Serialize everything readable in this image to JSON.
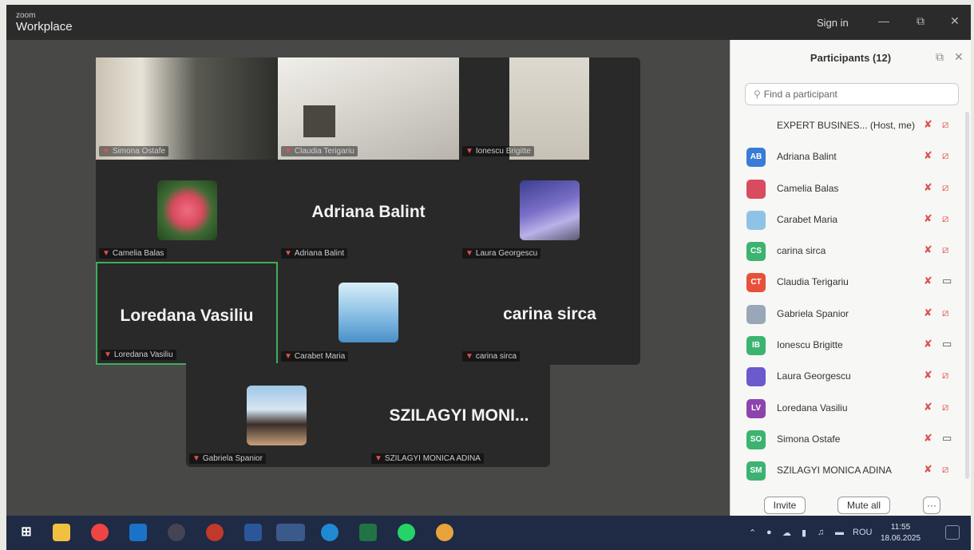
{
  "titlebar": {
    "brand_small": "zoom",
    "brand_name": "Workplace",
    "sign_in": "Sign in",
    "minimize": "—",
    "restore": "⧉",
    "close": "✕"
  },
  "gallery": {
    "tiles": [
      {
        "label": "Simona Ostafe",
        "center_name": ""
      },
      {
        "label": "Claudia Terigariu",
        "center_name": ""
      },
      {
        "label": "Ionescu Brigitte",
        "center_name": ""
      },
      {
        "label": "Camelia Balas",
        "center_name": ""
      },
      {
        "label": "Adriana Balint",
        "center_name": "Adriana Balint"
      },
      {
        "label": "Laura Georgescu",
        "center_name": ""
      },
      {
        "label": "Loredana Vasiliu",
        "center_name": "Loredana Vasiliu"
      },
      {
        "label": "Carabet Maria",
        "center_name": ""
      },
      {
        "label": "carina sirca",
        "center_name": "carina sirca"
      },
      {
        "label": "Gabriela Spanior",
        "center_name": ""
      },
      {
        "label": "SZILAGYI MONICA ADINA",
        "center_name": "SZILAGYI  MONI..."
      }
    ],
    "active_speaker_color": "#3fae5a"
  },
  "participants": {
    "title": "Participants (12)",
    "popout_icon": "⧉",
    "close_icon": "✕",
    "search_placeholder": "Find a participant",
    "list": [
      {
        "initials": "",
        "name": "EXPERT BUSINES... (Host, me)",
        "color": "#ffffff",
        "mic": "muted",
        "cam": "off"
      },
      {
        "initials": "AB",
        "name": "Adriana Balint",
        "color": "#3a7bd5",
        "mic": "muted",
        "cam": "off"
      },
      {
        "initials": "",
        "name": "Camelia Balas",
        "color": "#d94b5f",
        "mic": "muted",
        "cam": "off"
      },
      {
        "initials": "",
        "name": "Carabet Maria",
        "color": "#8fc3e6",
        "mic": "muted",
        "cam": "off"
      },
      {
        "initials": "CS",
        "name": "carina sirca",
        "color": "#3cb371",
        "mic": "muted",
        "cam": "off"
      },
      {
        "initials": "CT",
        "name": "Claudia Terigariu",
        "color": "#e8503a",
        "mic": "muted",
        "cam": "on"
      },
      {
        "initials": "",
        "name": "Gabriela Spanior",
        "color": "#9aa7b8",
        "mic": "muted",
        "cam": "off"
      },
      {
        "initials": "IB",
        "name": "Ionescu Brigitte",
        "color": "#3cb371",
        "mic": "muted",
        "cam": "on"
      },
      {
        "initials": "",
        "name": "Laura Georgescu",
        "color": "#6a5acd",
        "mic": "muted",
        "cam": "off"
      },
      {
        "initials": "LV",
        "name": "Loredana Vasiliu",
        "color": "#8e44ad",
        "mic": "muted",
        "cam": "off"
      },
      {
        "initials": "SO",
        "name": "Simona Ostafe",
        "color": "#3cb371",
        "mic": "muted",
        "cam": "on"
      },
      {
        "initials": "SM",
        "name": "SZILAGYI MONICA ADINA",
        "color": "#3cb371",
        "mic": "muted",
        "cam": "off"
      }
    ],
    "invite_label": "Invite",
    "mute_all_label": "Mute all",
    "more_label": "···"
  },
  "taskbar": {
    "language": "ROU",
    "time": "11:55",
    "date": "18.06.2025"
  }
}
